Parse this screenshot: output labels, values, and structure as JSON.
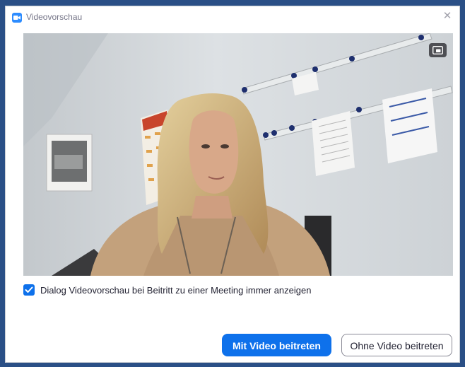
{
  "window": {
    "title": "Videovorschau",
    "close_symbol": "✕"
  },
  "preview": {
    "content": "camera-feed",
    "pip_icon": "picture-in-picture-icon"
  },
  "options": {
    "always_show_preview_label": "Dialog Videovorschau bei Beitritt zu einer Meeting immer anzeigen",
    "always_show_preview_checked": true
  },
  "buttons": {
    "join_with_video": "Mit Video beitreten",
    "join_without_video": "Ohne Video beitreten"
  },
  "colors": {
    "accent": "#0e71eb",
    "app_icon": "#2d8cff",
    "title_text": "#747487",
    "body_text": "#232333"
  }
}
